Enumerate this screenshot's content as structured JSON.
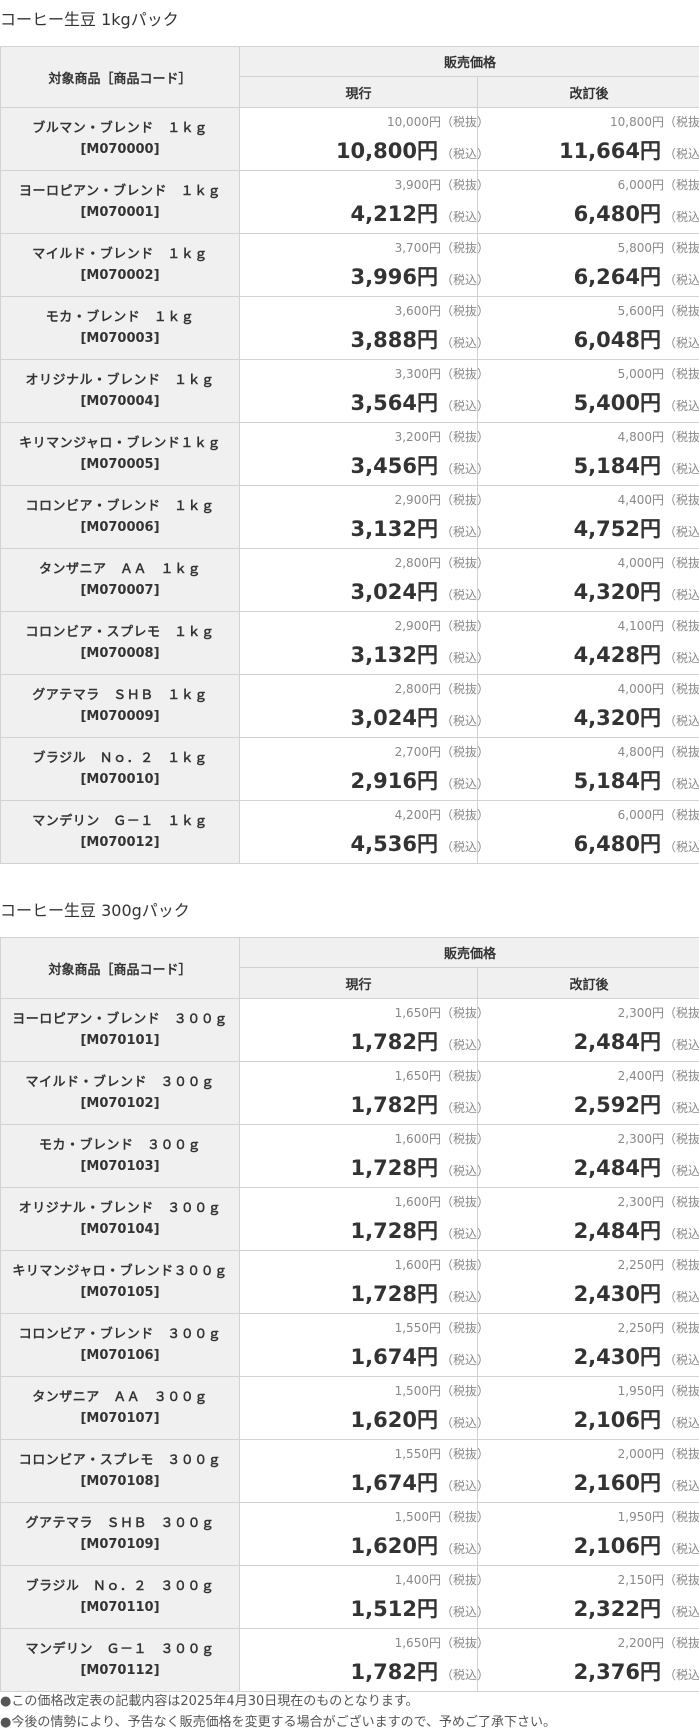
{
  "labels": {
    "product_header": "対象商品［商品コード］",
    "price_header": "販売価格",
    "current_header": "現行",
    "revised_header": "改訂後",
    "yen": "円",
    "tax_excluded": "（税抜）",
    "tax_included": "（税込）"
  },
  "sections": [
    {
      "title": "コーヒー生豆 1kgパック",
      "rows": [
        {
          "name": "ブルマン・ブレンド　１ｋｇ",
          "code": "[M070000]",
          "current_ex": "10,000",
          "current_in": "10,800",
          "revised_ex": "10,800",
          "revised_in": "11,664"
        },
        {
          "name": "ヨーロピアン・ブレンド　１ｋｇ",
          "code": "[M070001]",
          "current_ex": "3,900",
          "current_in": "4,212",
          "revised_ex": "6,000",
          "revised_in": "6,480"
        },
        {
          "name": "マイルド・ブレンド　１ｋｇ",
          "code": "[M070002]",
          "current_ex": "3,700",
          "current_in": "3,996",
          "revised_ex": "5,800",
          "revised_in": "6,264"
        },
        {
          "name": "モカ・ブレンド　１ｋｇ",
          "code": "[M070003]",
          "current_ex": "3,600",
          "current_in": "3,888",
          "revised_ex": "5,600",
          "revised_in": "6,048"
        },
        {
          "name": "オリジナル・ブレンド　１ｋｇ",
          "code": "[M070004]",
          "current_ex": "3,300",
          "current_in": "3,564",
          "revised_ex": "5,000",
          "revised_in": "5,400"
        },
        {
          "name": "キリマンジャロ・ブレンド１ｋｇ",
          "code": "[M070005]",
          "current_ex": "3,200",
          "current_in": "3,456",
          "revised_ex": "4,800",
          "revised_in": "5,184"
        },
        {
          "name": "コロンビア・ブレンド　１ｋｇ",
          "code": "[M070006]",
          "current_ex": "2,900",
          "current_in": "3,132",
          "revised_ex": "4,400",
          "revised_in": "4,752"
        },
        {
          "name": "タンザニア　ＡＡ　１ｋｇ",
          "code": "[M070007]",
          "current_ex": "2,800",
          "current_in": "3,024",
          "revised_ex": "4,000",
          "revised_in": "4,320"
        },
        {
          "name": "コロンビア・スプレモ　１ｋｇ",
          "code": "[M070008]",
          "current_ex": "2,900",
          "current_in": "3,132",
          "revised_ex": "4,100",
          "revised_in": "4,428"
        },
        {
          "name": "グアテマラ　ＳＨＢ　１ｋｇ",
          "code": "[M070009]",
          "current_ex": "2,800",
          "current_in": "3,024",
          "revised_ex": "4,000",
          "revised_in": "4,320"
        },
        {
          "name": "ブラジル　Ｎｏ．２　１ｋｇ",
          "code": "[M070010]",
          "current_ex": "2,700",
          "current_in": "2,916",
          "revised_ex": "4,800",
          "revised_in": "5,184"
        },
        {
          "name": "マンデリン　Ｇ－１　１ｋｇ",
          "code": "[M070012]",
          "current_ex": "4,200",
          "current_in": "4,536",
          "revised_ex": "6,000",
          "revised_in": "6,480"
        }
      ]
    },
    {
      "title": "コーヒー生豆 300gパック",
      "rows": [
        {
          "name": "ヨーロピアン・ブレンド　３００ｇ",
          "code": "[M070101]",
          "current_ex": "1,650",
          "current_in": "1,782",
          "revised_ex": "2,300",
          "revised_in": "2,484"
        },
        {
          "name": "マイルド・ブレンド　３００ｇ",
          "code": "[M070102]",
          "current_ex": "1,650",
          "current_in": "1,782",
          "revised_ex": "2,400",
          "revised_in": "2,592"
        },
        {
          "name": "モカ・ブレンド　３００ｇ",
          "code": "[M070103]",
          "current_ex": "1,600",
          "current_in": "1,728",
          "revised_ex": "2,300",
          "revised_in": "2,484"
        },
        {
          "name": "オリジナル・ブレンド　３００ｇ",
          "code": "[M070104]",
          "current_ex": "1,600",
          "current_in": "1,728",
          "revised_ex": "2,300",
          "revised_in": "2,484"
        },
        {
          "name": "キリマンジャロ・ブレンド３００ｇ",
          "code": "[M070105]",
          "current_ex": "1,600",
          "current_in": "1,728",
          "revised_ex": "2,250",
          "revised_in": "2,430"
        },
        {
          "name": "コロンビア・ブレンド　３００ｇ",
          "code": "[M070106]",
          "current_ex": "1,550",
          "current_in": "1,674",
          "revised_ex": "2,250",
          "revised_in": "2,430"
        },
        {
          "name": "タンザニア　ＡＡ　３００ｇ",
          "code": "[M070107]",
          "current_ex": "1,500",
          "current_in": "1,620",
          "revised_ex": "1,950",
          "revised_in": "2,106"
        },
        {
          "name": "コロンビア・スプレモ　３００ｇ",
          "code": "[M070108]",
          "current_ex": "1,550",
          "current_in": "1,674",
          "revised_ex": "2,000",
          "revised_in": "2,160"
        },
        {
          "name": "グアテマラ　ＳＨＢ　３００ｇ",
          "code": "[M070109]",
          "current_ex": "1,500",
          "current_in": "1,620",
          "revised_ex": "1,950",
          "revised_in": "2,106"
        },
        {
          "name": "ブラジル　Ｎｏ．２　３００ｇ",
          "code": "[M070110]",
          "current_ex": "1,400",
          "current_in": "1,512",
          "revised_ex": "2,150",
          "revised_in": "2,322"
        },
        {
          "name": "マンデリン　Ｇ－１　３００ｇ",
          "code": "[M070112]",
          "current_ex": "1,650",
          "current_in": "1,782",
          "revised_ex": "2,200",
          "revised_in": "2,376"
        }
      ]
    }
  ],
  "notes": [
    "●この価格改定表の記載内容は2025年4月30日現在のものとなります。",
    "●今後の情勢により、予告なく販売価格を変更する場合がございますので、予めご了承下さい。"
  ]
}
